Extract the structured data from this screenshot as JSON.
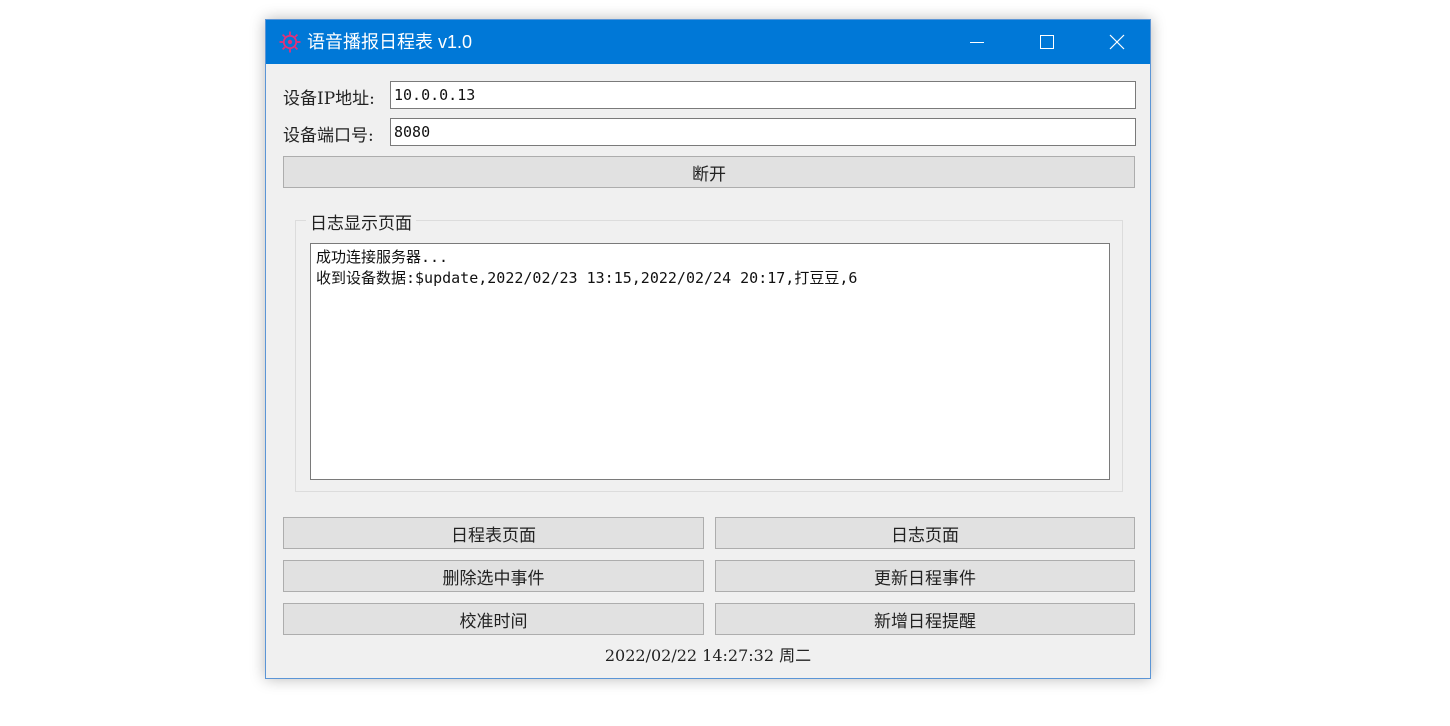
{
  "window": {
    "title": "语音播报日程表 v1.0",
    "accent_color": "#0078d7",
    "icon": "gear-cog-icon",
    "controls": [
      "minimize-icon",
      "maximize-icon",
      "close-icon"
    ]
  },
  "connection": {
    "ip_label": "设备IP地址:",
    "ip_value": "10.0.0.13",
    "port_label": "设备端口号:",
    "port_value": "8080",
    "connect_button": "断开"
  },
  "log": {
    "group_title": "日志显示页面",
    "lines": [
      "成功连接服务器...",
      "收到设备数据:$update,2022/02/23 13:15,2022/02/24 20:17,打豆豆,6"
    ]
  },
  "actions": {
    "schedule_page": "日程表页面",
    "log_page": "日志页面",
    "delete_selected": "删除选中事件",
    "update_schedule": "更新日程事件",
    "calibrate_time": "校准时间",
    "add_reminder": "新增日程提醒"
  },
  "status": {
    "datetime": "2022/02/22 14:27:32 周二"
  }
}
